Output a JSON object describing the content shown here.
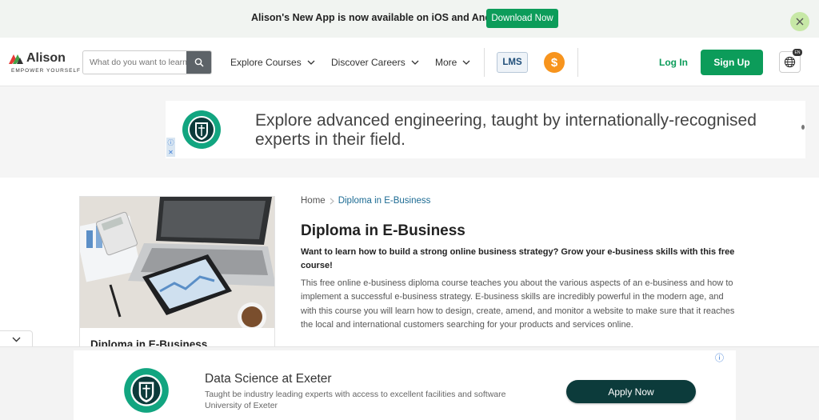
{
  "app_banner": {
    "message": "Alison's New App is now available on iOS and Android!",
    "download_label": "Download Now"
  },
  "header": {
    "logo_name": "Alison",
    "logo_tagline": "EMPOWER YOURSELF",
    "search_placeholder": "What do you want to learn?",
    "nav": {
      "explore": "Explore Courses",
      "discover": "Discover Careers",
      "more": "More"
    },
    "lms_label": "LMS",
    "coin_symbol": "$",
    "login_label": "Log In",
    "signup_label": "Sign Up",
    "lang_badge": "EN"
  },
  "ad_top": {
    "text": "Explore advanced engineering, taught by internationally-recognised experts in their field."
  },
  "course": {
    "card_title": "Diploma in E-Business",
    "breadcrumb_home": "Home",
    "breadcrumb_current": "Diploma in E-Business",
    "title": "Diploma in E-Business",
    "lead": "Want to learn how to build a strong online business strategy? Grow your e-business skills with this free course!",
    "description": "This free online e-business diploma course teaches you about the various aspects of an e-business and how to implement a successful e-business strategy. E-business skills are incredibly powerful in the modern age, and with this course you will learn how to design, create, amend, and monitor a website to make sure that it reaches the local and international customers searching for your products and services online."
  },
  "ad_bottom": {
    "title": "Data Science at Exeter",
    "subtitle": "Taught be industry leading experts with access to excellent facilities and software",
    "org": "University of Exeter",
    "cta": "Apply Now"
  },
  "colors": {
    "brand_green": "#0c9c5a",
    "coin_orange": "#f7941d",
    "apply_dark": "#0c3b3b",
    "seal_green": "#12a580"
  }
}
